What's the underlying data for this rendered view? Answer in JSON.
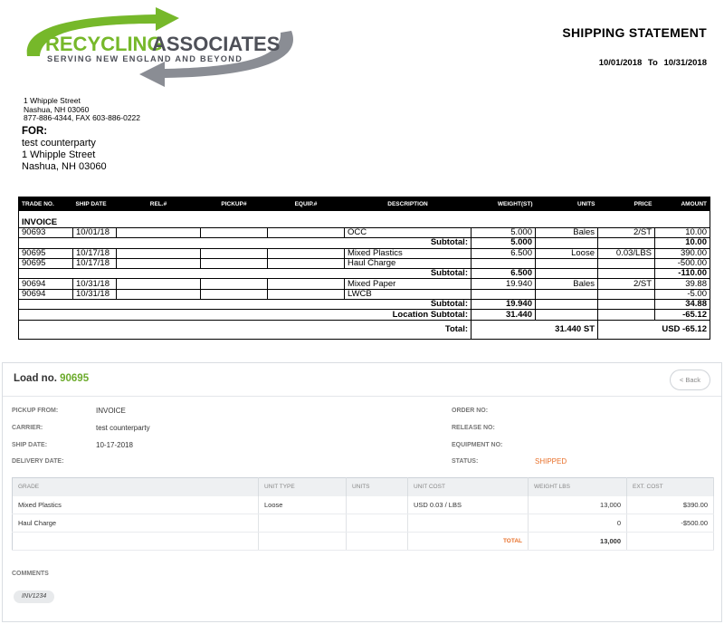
{
  "logo": {
    "name_part1": "RECYCLING",
    "name_part2": "ASSOCIATES",
    "tagline": "SERVING NEW ENGLAND AND BEYOND",
    "colors": {
      "green": "#76b82a",
      "gray": "#8a8d94",
      "dark": "#4e5058"
    }
  },
  "header": {
    "title": "SHIPPING STATEMENT",
    "date_from": "10/01/2018",
    "date_sep": "To",
    "date_to": "10/31/2018"
  },
  "company": {
    "street": "1 Whipple Street",
    "city": "Nashua, NH   03060",
    "phone": "877-886-4344, FAX 603-886-0222"
  },
  "for": {
    "label": "FOR:",
    "name": "test counterparty",
    "street": "1 Whipple Street",
    "city": "Nashua, NH  03060"
  },
  "statement": {
    "columns": [
      "TRADE NO.",
      "SHIP DATE",
      "REL.#",
      "PICKUP#",
      "EQUIP.#",
      "DESCRIPTION",
      "WEIGHT(ST)",
      "UNITS",
      "PRICE",
      "AMOUNT"
    ],
    "section_label": "INVOICE",
    "groups": [
      {
        "rows": [
          {
            "trade": "90693",
            "date": "10/01/18",
            "desc": "OCC",
            "weight": "5.000",
            "units": "Bales",
            "price": "2/ST",
            "amount": "10.00"
          }
        ],
        "subtotal_label": "Subtotal:",
        "subtotal_weight": "5.000",
        "subtotal_amount": "10.00"
      },
      {
        "rows": [
          {
            "trade": "90695",
            "date": "10/17/18",
            "desc": "Mixed Plastics",
            "weight": "6.500",
            "units": "Loose",
            "price": "0.03/LBS",
            "amount": "390.00"
          },
          {
            "trade": "90695",
            "date": "10/17/18",
            "desc": "Haul Charge",
            "weight": "",
            "units": "",
            "price": "",
            "amount": "-500.00"
          }
        ],
        "subtotal_label": "Subtotal:",
        "subtotal_weight": "6.500",
        "subtotal_amount": "-110.00"
      },
      {
        "rows": [
          {
            "trade": "90694",
            "date": "10/31/18",
            "desc": "Mixed Paper",
            "weight": "19.940",
            "units": "Bales",
            "price": "2/ST",
            "amount": "39.88"
          },
          {
            "trade": "90694",
            "date": "10/31/18",
            "desc": "LWCB",
            "weight": "",
            "units": "",
            "price": "",
            "amount": "-5.00"
          }
        ],
        "subtotal_label": "Subtotal:",
        "subtotal_weight": "19.940",
        "subtotal_amount": "34.88"
      }
    ],
    "location_subtotal_label": "Location Subtotal:",
    "location_subtotal_weight": "31.440",
    "location_subtotal_amount": "-65.12",
    "total_label": "Total:",
    "total_weight": "31.440 ST",
    "total_amount": "USD -65.12"
  },
  "load": {
    "title_prefix": "Load no.",
    "number": "90695",
    "back_label": "< Back",
    "fields_left": [
      {
        "label": "PICKUP FROM:",
        "value": "INVOICE"
      },
      {
        "label": "CARRIER:",
        "value": "test counterparty"
      },
      {
        "label": "SHIP DATE:",
        "value": "10-17-2018"
      },
      {
        "label": "DELIVERY DATE:",
        "value": ""
      }
    ],
    "fields_right": [
      {
        "label": "ORDER NO:",
        "value": ""
      },
      {
        "label": "RELEASE NO:",
        "value": ""
      },
      {
        "label": "EQUIPMENT NO:",
        "value": ""
      },
      {
        "label": "STATUS:",
        "value": "SHIPPED"
      }
    ],
    "grid": {
      "columns": [
        "GRADE",
        "UNIT TYPE",
        "UNITS",
        "UNIT COST",
        "WEIGHT LBS",
        "EXT. COST"
      ],
      "rows": [
        [
          "Mixed Plastics",
          "Loose",
          "",
          "USD 0.03 / LBS",
          "13,000",
          "$390.00"
        ],
        [
          "Haul Charge",
          "",
          "",
          "",
          "0",
          "-$500.00"
        ]
      ],
      "total_label": "TOTAL",
      "total_weight": "13,000"
    },
    "comments_label": "COMMENTS",
    "comment_tag": "INV1234"
  }
}
